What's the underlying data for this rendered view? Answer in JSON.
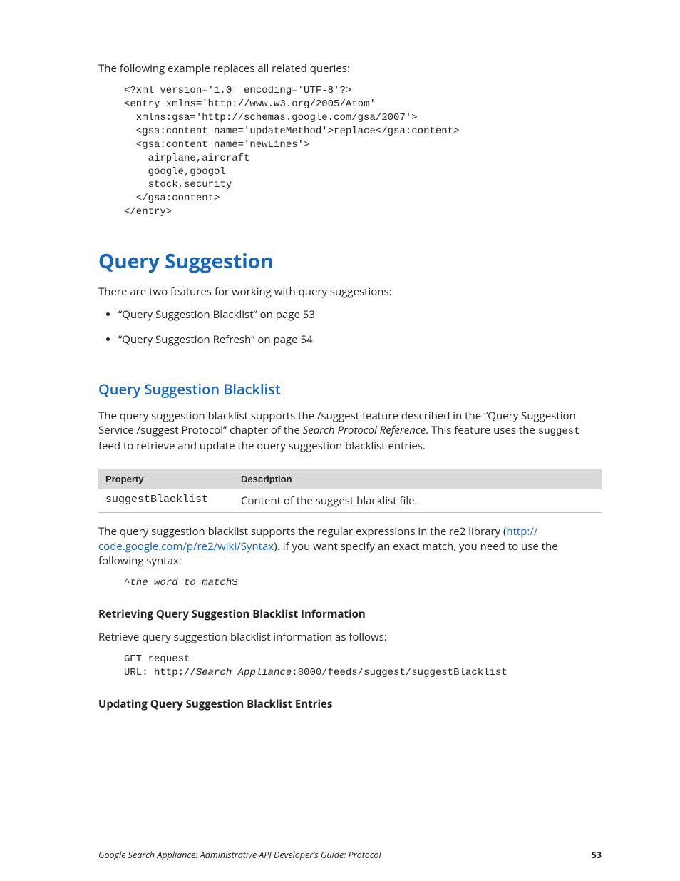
{
  "intro": "The following example replaces all related queries:",
  "code1": "<?xml version='1.0' encoding='UTF-8'?>\n<entry xmlns='http://www.w3.org/2005/Atom'\n  xmlns:gsa='http://schemas.google.com/gsa/2007'>\n  <gsa:content name='updateMethod'>replace</gsa:content>\n  <gsa:content name='newLines'>\n    airplane,aircraft\n    google,googol\n    stock,security\n  </gsa:content>\n</entry>",
  "h1": "Query Suggestion",
  "p_features": "There are two features for working with query suggestions:",
  "bullets": [
    "“Query Suggestion Blacklist” on page 53",
    "“Query Suggestion Refresh” on page 54"
  ],
  "h2": "Query Suggestion Blacklist",
  "p_blacklist_1a": "The query suggestion blacklist supports the /suggest feature described in the “Query Suggestion Service /suggest Protocol” chapter of the ",
  "p_blacklist_1b": "Search Protocol Reference",
  "p_blacklist_1c": ". This feature uses the ",
  "p_blacklist_1d": "suggest",
  "p_blacklist_1e": " feed to retrieve and update the query suggestion blacklist entries.",
  "table": {
    "h1": "Property",
    "h2": "Description",
    "r1c1": "suggestBlacklist",
    "r1c2": "Content of the suggest blacklist file."
  },
  "p_regex_a": "The query suggestion blacklist supports the regular expressions in the re2 library (",
  "p_regex_link1": "http://",
  "p_regex_link2": "code.google.com/p/re2/wiki/Syntax",
  "p_regex_b": "). If you want specify an exact match, you need to use the following syntax:",
  "code2_a": "^",
  "code2_b": "the_word_to_match",
  "code2_c": "$",
  "subhead1": "Retrieving Query Suggestion Blacklist Information",
  "p_retrieve": "Retrieve query suggestion blacklist information as follows:",
  "code3_a": "GET request\nURL: http://",
  "code3_b": "Search_Appliance",
  "code3_c": ":8000/feeds/suggest/suggestBlacklist",
  "subhead2": "Updating Query Suggestion Blacklist Entries",
  "footer": {
    "title": "Google Search Appliance: Administrative API Developer’s Guide: Protocol",
    "page": "53"
  }
}
